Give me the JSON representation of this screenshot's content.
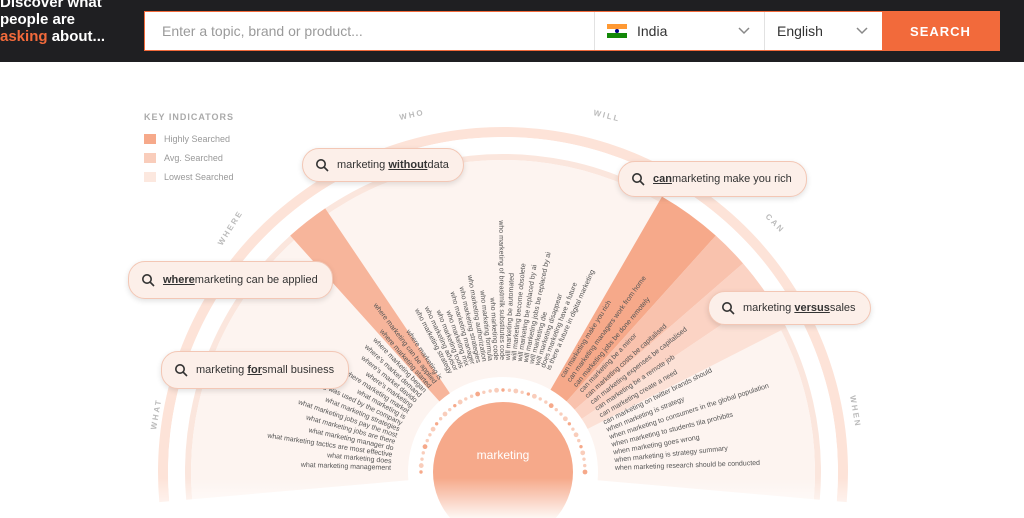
{
  "header": {
    "tagline_line1": "Discover what",
    "tagline_line2": "people are",
    "tagline_accent": "asking",
    "tagline_rest": " about...",
    "search_placeholder": "Enter a topic, brand or product...",
    "country": "India",
    "language": "English",
    "search_button": "SEARCH"
  },
  "legend": {
    "title": "KEY INDICATORS",
    "items": [
      {
        "label": "Highly Searched",
        "color": "#f6a98a"
      },
      {
        "label": "Avg. Searched",
        "color": "#f9cdbb"
      },
      {
        "label": "Lowest Searched",
        "color": "#fce8df"
      }
    ]
  },
  "ring_labels": {
    "who": "WHO",
    "will": "WILL",
    "where": "WHERE",
    "can": "CAN",
    "what": "WHAT",
    "when": "WHEN"
  },
  "center": {
    "label": "marketing"
  },
  "bubbles": [
    {
      "pre": "marketing ",
      "key": "without",
      "post": " data"
    },
    {
      "pre": "",
      "key": "can",
      "post": " marketing make you rich"
    },
    {
      "pre": "",
      "key": "where",
      "post": " marketing can be applied"
    },
    {
      "pre": "marketing ",
      "key": "versus",
      "post": " sales"
    },
    {
      "pre": "marketing ",
      "key": "for",
      "post": " small business"
    }
  ],
  "questions": {
    "left": [
      "what marketing management",
      "what marketing does",
      "what marketing tactics are most effective",
      "what marketing manager do",
      "what marketing jobs are there",
      "what marketing jobs pay the most",
      "what marketing strategies",
      "what marketing was used by the company",
      "what marketing is",
      "where marketing market",
      "where's marketing",
      "where's market davido",
      "where's market demand",
      "where marketing began",
      "where marketing started",
      "where marketing can be applied",
      "where marketing is"
    ],
    "top": [
      "who marketing strategy",
      "who marketing advisor",
      "who marketing tools",
      "who marketing mix",
      "who marketing manager",
      "who marketing strategies",
      "who marketing authorization",
      "who marketing formula",
      "who marketing code",
      "who marketing of breastmilk substitutes code",
      "will marketing be automated",
      "will marketing become obsolete",
      "will marketing be replaced by ai",
      "will marketing jobs be replaced by ai",
      "will marketing die",
      "will marketing disappear",
      "does marketing have a future",
      "is there a future in digital marketing"
    ],
    "right": [
      "can marketing make you rich",
      "can marketing managers work from home",
      "can marketing jobs be done remotely",
      "can marketing be a minor",
      "can marketing costs be capitalised",
      "can marketing expenses be capitalised",
      "can marketing be a remote job",
      "can marketing create a need",
      "can marketing on twitter brands should",
      "when marketing is strategy",
      "when marketing to consumers in the global population",
      "when marketing to students tila prohibits",
      "when marketing goes wrong",
      "when marketing is strategy summary",
      "when marketing research should be conducted"
    ]
  }
}
